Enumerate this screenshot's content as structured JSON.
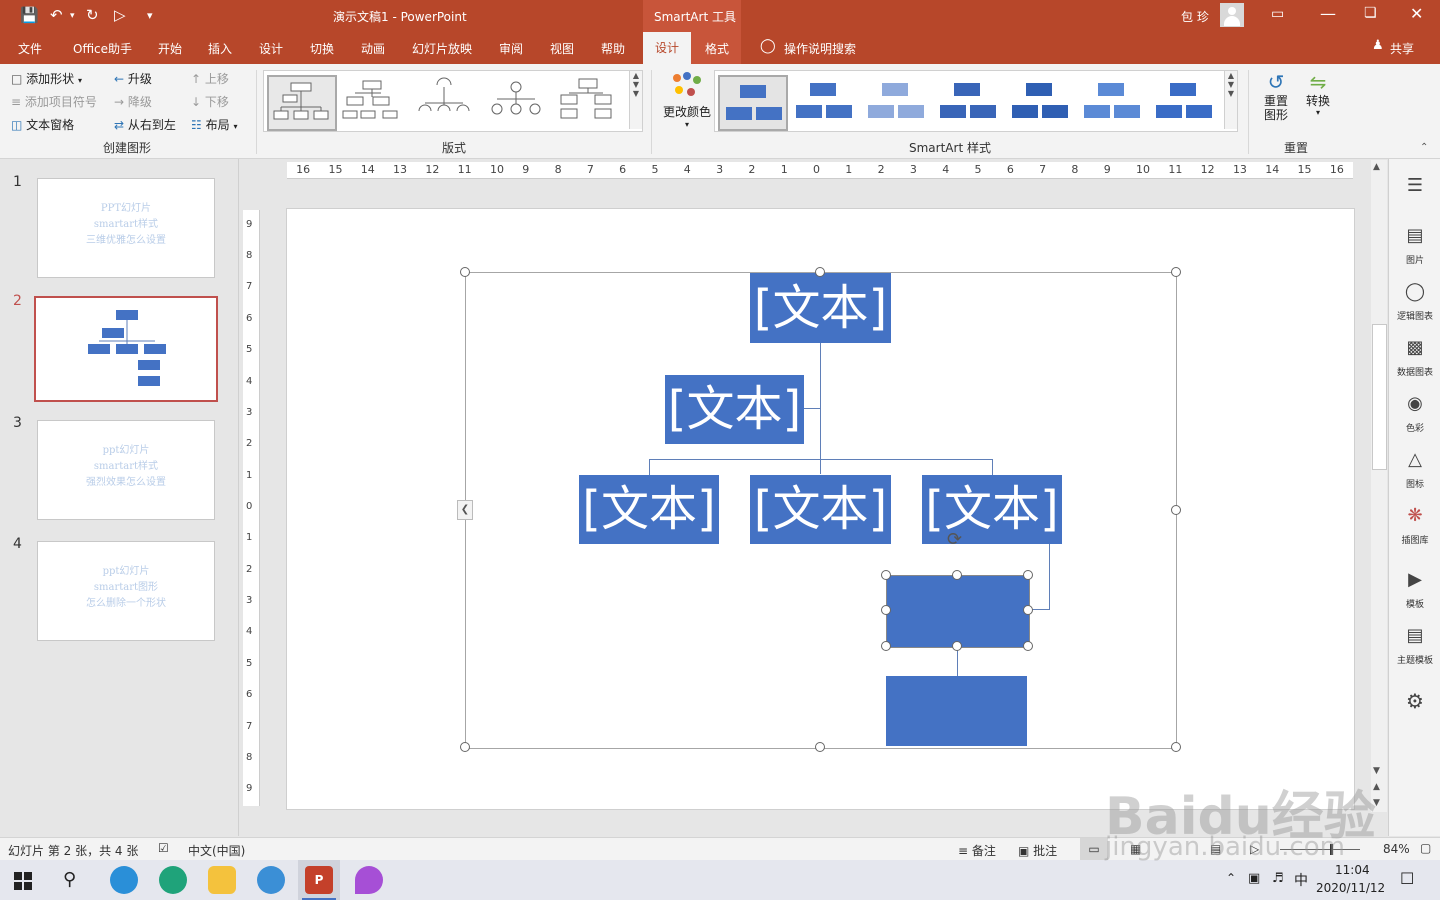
{
  "titlebar": {
    "doc_title": "演示文稿1  -  PowerPoint",
    "context_tool": "SmartArt 工具",
    "user": "包 珍",
    "share": "共享"
  },
  "tabs": [
    "文件",
    "Office助手",
    "开始",
    "插入",
    "设计",
    "切换",
    "动画",
    "幻灯片放映",
    "审阅",
    "视图",
    "帮助",
    "设计",
    "格式"
  ],
  "active_tab_index": 11,
  "tell_me": "操作说明搜索",
  "ribbon": {
    "create_group": {
      "add_shape": "添加形状",
      "promote": "升级",
      "move_up": "上移",
      "add_bullet": "添加项目符号",
      "demote": "降级",
      "move_down": "下移",
      "text_pane": "文本窗格",
      "rtl": "从右到左",
      "layout": "布局",
      "label": "创建图形"
    },
    "layouts_label": "版式",
    "change_colors": "更改颜色",
    "styles_label": "SmartArt 样式",
    "reset_graphic": "重置\n图形",
    "reset_line1": "重置",
    "reset_line2": "图形",
    "convert": "转换",
    "reset_label": "重置"
  },
  "thumbnails": [
    {
      "num": "1",
      "lines": [
        "PPT幻灯片",
        "smartart样式",
        "三维优雅怎么设置"
      ]
    },
    {
      "num": "2",
      "lines": []
    },
    {
      "num": "3",
      "lines": [
        "ppt幻灯片",
        "smartart样式",
        "强烈效果怎么设置"
      ]
    },
    {
      "num": "4",
      "lines": [
        "ppt幻灯片",
        "smartart图形",
        "怎么删除一个形状"
      ]
    }
  ],
  "selected_slide": 2,
  "ruler": {
    "h_ticks": [
      "16",
      "15",
      "14",
      "13",
      "12",
      "11",
      "10",
      "9",
      "8",
      "7",
      "6",
      "5",
      "4",
      "3",
      "2",
      "1",
      "0",
      "1",
      "2",
      "3",
      "4",
      "5",
      "6",
      "7",
      "8",
      "9",
      "10",
      "11",
      "12",
      "13",
      "14",
      "15",
      "16"
    ],
    "v_ticks": [
      "9",
      "8",
      "7",
      "6",
      "5",
      "4",
      "3",
      "2",
      "1",
      "0",
      "1",
      "2",
      "3",
      "4",
      "5",
      "6",
      "7",
      "8",
      "9"
    ]
  },
  "smartart": {
    "placeholder": "[文本]"
  },
  "sidepane": [
    {
      "icon": "picture-icon",
      "label": "图片"
    },
    {
      "icon": "logic-chart-icon",
      "label": "逻辑图表"
    },
    {
      "icon": "data-chart-icon",
      "label": "数据图表"
    },
    {
      "icon": "palette-icon",
      "label": "色彩"
    },
    {
      "icon": "shapes-icon",
      "label": "图标"
    },
    {
      "icon": "clipart-icon",
      "label": "插图库"
    },
    {
      "icon": "template-icon",
      "label": "模板"
    },
    {
      "icon": "theme-template-icon",
      "label": "主题模板"
    }
  ],
  "status": {
    "slide_info": "幻灯片 第 2 张，共 4 张",
    "language": "中文(中国)",
    "notes": "备注",
    "comments": "批注",
    "zoom": "84%"
  },
  "taskbar": {
    "time": "11:04",
    "date": "2020/11/12",
    "ime": "中"
  },
  "watermark": {
    "main": "Baidu经验",
    "sub": "jingyan.baidu.com"
  },
  "colors": {
    "accent": "#b7472a",
    "smartart_fill": "#4472c4"
  }
}
